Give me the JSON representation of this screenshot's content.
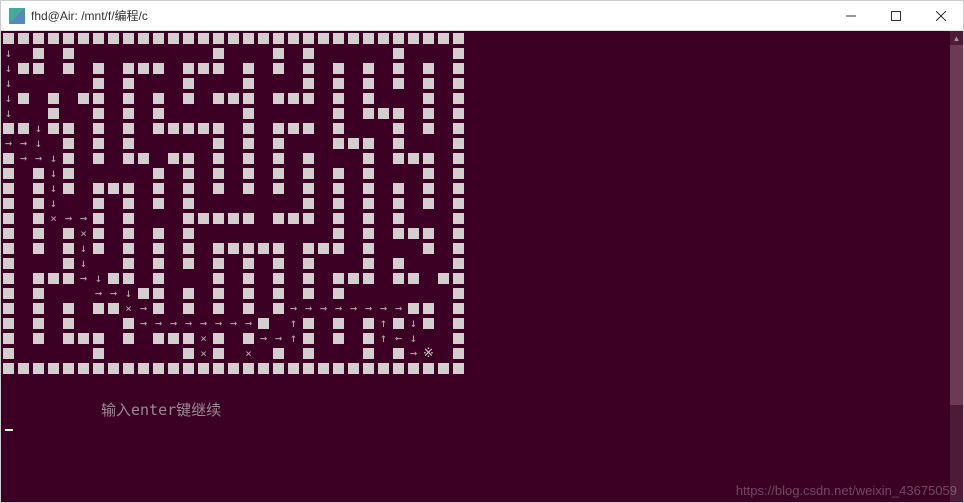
{
  "window": {
    "title": "fhd@Air: /mnt/f/编程/c"
  },
  "terminal": {
    "prompt": "输入enter键继续",
    "maze": {
      "legend": {
        "W": "wall",
        ".": "empty",
        ">": "arrow-right",
        "<": "arrow-left",
        "^": "arrow-up",
        "v": "arrow-down",
        "X": "visited-mark",
        "*": "goal"
      },
      "rows": [
        "WWWWWWWWWWWWWWWWWWWWWWWWWWWWWWW",
        "v.W.W.........W...W.W.....W...W",
        "vWW.W.W.WWW.WWW.W.W.W.W.W.W.W.W",
        "v.....W.W...W...W...W.W.W.W.W.W",
        "vW.W.WW.W.W.W.WWW.WWW.W.W...W.W",
        "v..W..W.W.W.....W.....W.WWW.W.W",
        "WWvWW.W.W.WWWWW.W.WWW.W...W.W.W",
        ">>v.W.W.W.....W.W.W...WWW.W...W",
        "W>>vW.W.WW.WW.W.W.W.W...W.WWW.W",
        "W.WvW.....W.W.W.W.W.W.W.W...W.W",
        "W.WvW.WWW.W.W.W.W.W.W.W.W.W.W.W",
        "W.Wv..W.W.W.W.......W.W.W.W.W.W",
        "W.WX>>W.W...WWWWW.WWW.W.W.W...W",
        "W.W.WXW.W.W.W.........W.W.WWW.W",
        "W.W.WvW.W.W.W.WWWWW.WWW.W...W.W",
        "W...Wv..W.W.W.W.W.W.W...W.W...W",
        "W.WWW>vWW.W...W.W.W.W.WWW.WW.WW",
        "W.W...>>vWW.W.W.W.W.W.W.......W",
        "W.W.W.WWX>W.W.W.W.W>>>>>>>>WW.W",
        "W.W.W...W>>>>>>>>W.^W.W.W^WvW.W",
        "W.W.WWW.W.WWWXW.W>>^W.W.W^<v..W",
        "W.....W.....WXW.X.W.W...W.W>*.W",
        "WWWWWWWWWWWWWWWWWWWWWWWWWWWWWWW"
      ]
    }
  },
  "watermark": "https://blog.csdn.net/weixin_43675059",
  "colors": {
    "terminal_bg": "#3b0023",
    "wall": "#d3cfcf",
    "text": "#9b8a95"
  }
}
